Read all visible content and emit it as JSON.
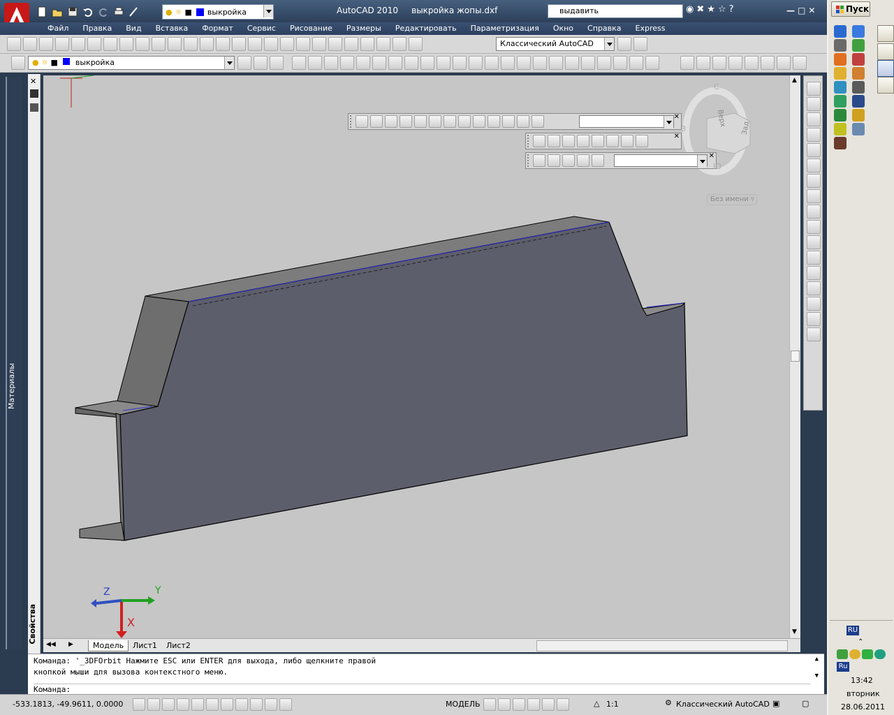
{
  "titlebar": {
    "app_title": "AutoCAD 2010",
    "doc_title": "выкройка жопы.dxf",
    "search_text": "выдавить",
    "qat_layer": "выкройка"
  },
  "menu": [
    "Файл",
    "Правка",
    "Вид",
    "Вставка",
    "Формат",
    "Сервис",
    "Рисование",
    "Размеры",
    "Редактировать",
    "Параметризация",
    "Окно",
    "Справка",
    "Express"
  ],
  "toolbar": {
    "workspace": "Классический AutoCAD",
    "layer": "выкройка"
  },
  "left_panels": {
    "materials": "Материалы",
    "properties": "Свойства"
  },
  "viewport": {
    "viewcube_top": "Верх",
    "viewcube_back": "Зад",
    "compass_n": "С",
    "compass_w": "З",
    "compass_s": "Ю",
    "ucs_name": "Без имени",
    "axis_x": "X",
    "axis_y": "Y",
    "axis_z": "Z"
  },
  "tabs": [
    "Модель",
    "Лист1",
    "Лист2"
  ],
  "command": {
    "history_line1": "Команда: '_3DFOrbit Нажмите ESC или ENTER для выхода, либо щелкните правой",
    "history_line2": "кнопкой мыши для вызова контекстного меню.",
    "prompt": "Команда:"
  },
  "statusbar": {
    "coords": "-533.1813, -49.9611, 0.0000",
    "model": "МОДЕЛЬ",
    "scale": "1:1",
    "workspace": "Классический AutoCAD"
  },
  "taskbar": {
    "start": "Пуск",
    "lang_top": "RU",
    "lang": "Ru",
    "time": "13:42",
    "day": "вторник",
    "date": "28.06.2011"
  },
  "colors": {
    "model_face": "#5d5e6c",
    "model_top": "#7d7d7d",
    "model_edge": "#000000",
    "edge_highlight": "#3030d0",
    "viewport_bg": "#c6c6c6",
    "title_bg": "#2c405a"
  }
}
